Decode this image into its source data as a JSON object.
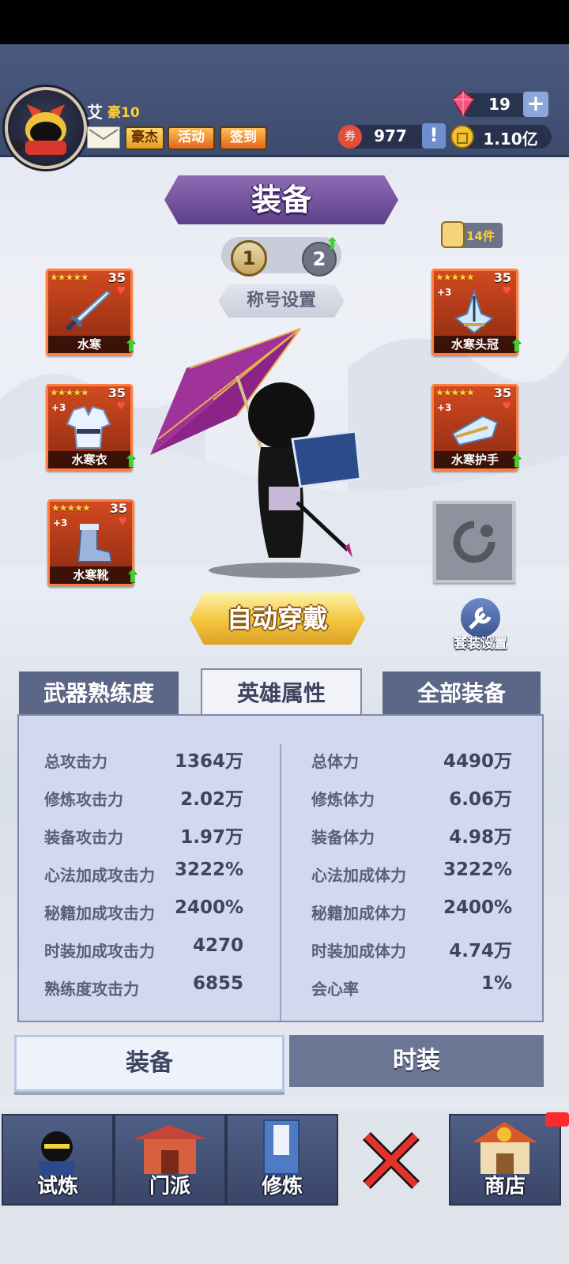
{
  "player": {
    "name": "艾",
    "vip": "豪10",
    "buttons": {
      "hero": "豪杰",
      "activity": "活动",
      "checkin": "签到"
    }
  },
  "currency": {
    "gems": "19",
    "tickets": "977",
    "gold": "1.10亿"
  },
  "header": {
    "title": "装备"
  },
  "loadout_tabs": [
    "1",
    "2"
  ],
  "title_setting": "称号设置",
  "bag": {
    "count_label": "14件"
  },
  "equipment": {
    "left": [
      {
        "name": "水寒",
        "stars": "★★★★★",
        "level": "35",
        "plus": ""
      },
      {
        "name": "水寒衣",
        "stars": "★★★★★",
        "level": "35",
        "plus": "+3"
      },
      {
        "name": "水寒靴",
        "stars": "★★★★★",
        "level": "35",
        "plus": "+3"
      }
    ],
    "right": [
      {
        "name": "水寒头冠",
        "stars": "★★★★★",
        "level": "35",
        "plus": "+3"
      },
      {
        "name": "水寒护手",
        "stars": "★★★★★",
        "level": "35",
        "plus": "+3"
      }
    ]
  },
  "auto_equip": "自动穿戴",
  "set_setting": "套装设置",
  "stat_tabs": [
    "武器熟练度",
    "英雄属性",
    "全部装备"
  ],
  "stats": {
    "left": [
      {
        "label": "总攻击力",
        "value": "1364万"
      },
      {
        "label": "修炼攻击力",
        "value": "2.02万"
      },
      {
        "label": "装备攻击力",
        "value": "1.97万"
      },
      {
        "label": "心法加成攻击力",
        "value": "3222%"
      },
      {
        "label": "秘籍加成攻击力",
        "value": "2400%"
      },
      {
        "label": "时装加成攻击力",
        "value": "4270"
      },
      {
        "label": "熟练度攻击力",
        "value": "6855"
      }
    ],
    "right": [
      {
        "label": "总体力",
        "value": "4490万"
      },
      {
        "label": "修炼体力",
        "value": "6.06万"
      },
      {
        "label": "装备体力",
        "value": "4.98万"
      },
      {
        "label": "心法加成体力",
        "value": "3222%"
      },
      {
        "label": "秘籍加成体力",
        "value": "2400%"
      },
      {
        "label": "时装加成体力",
        "value": "4.74万"
      },
      {
        "label": "会心率",
        "value": "1%"
      }
    ]
  },
  "bottom_tabs": [
    "装备",
    "时装"
  ],
  "nav": [
    "试炼",
    "门派",
    "修炼",
    "",
    "商店"
  ],
  "colors": {
    "accent_purple": "#6b4b96",
    "tab_active": "#f2f3f8",
    "tab_inactive": "#5c6686",
    "slot_red": "#b63a18"
  }
}
